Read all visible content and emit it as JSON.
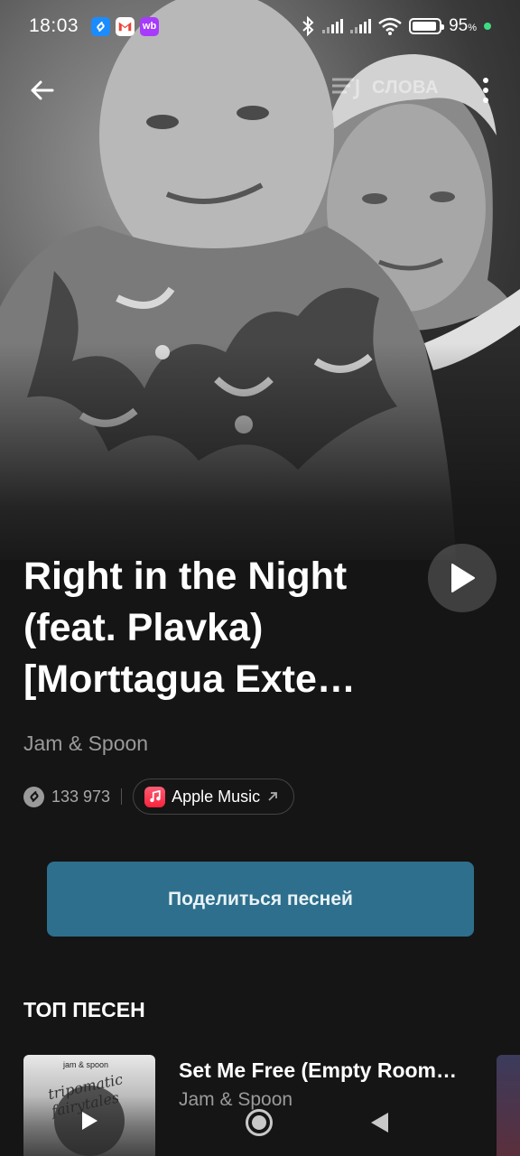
{
  "status_bar": {
    "time": "18:03",
    "battery": "95",
    "battery_unit": "%",
    "notifications": [
      "shazam-icon",
      "gmail-icon",
      "wb-icon"
    ],
    "notif_wb_text": "wb"
  },
  "top_bar": {
    "lyrics_label": "СЛОВА"
  },
  "song": {
    "title": "Right in the Night (feat. Plavka) [Morttagua Exte…",
    "artist": "Jam & Spoon",
    "shazam_count": "133 973",
    "apple_music_label": "Apple Music"
  },
  "share_button": "Поделиться песней",
  "top_songs": {
    "heading": "ТОП ПЕСЕН",
    "items": [
      {
        "title": "Set Me Free (Empty Room…",
        "artist": "Jam & Spoon",
        "cover_label": "jam & spoon",
        "cover_title": "tripomatic fairytales"
      }
    ]
  },
  "colors": {
    "background": "#151515",
    "share_button": "#2d6f8c",
    "apple_music": "#fa233b",
    "muted_text": "#9a9a9a"
  }
}
